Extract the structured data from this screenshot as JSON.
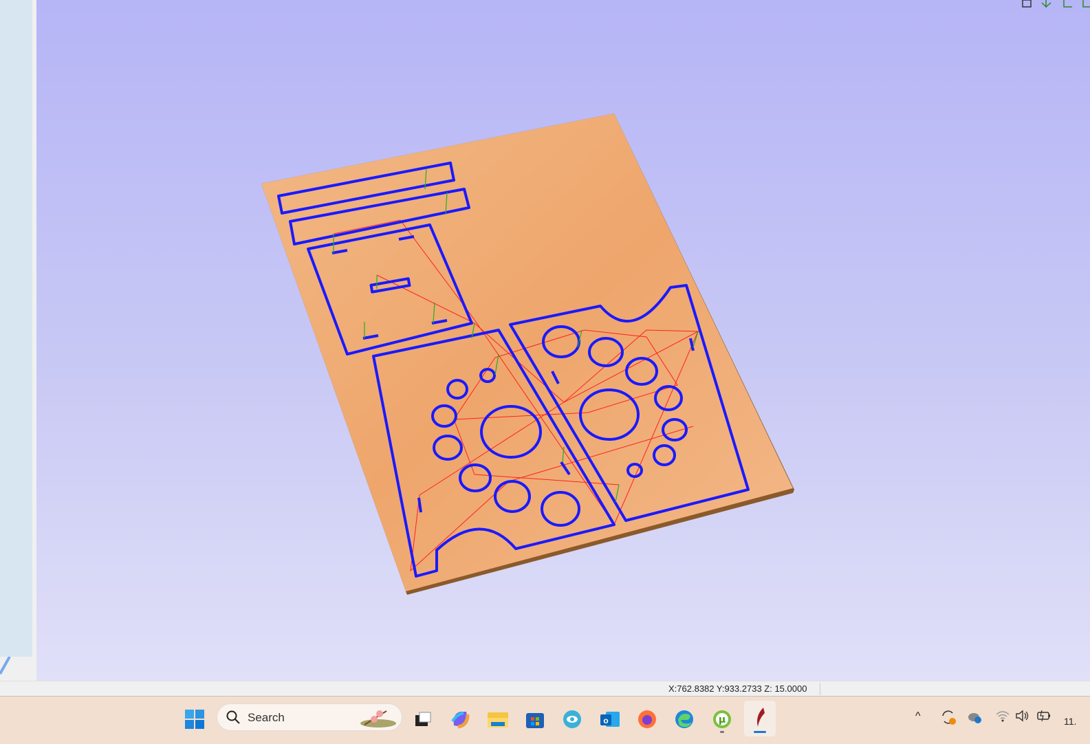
{
  "status": {
    "coords": "X:762.8382 Y:933.2733 Z: 15.0000"
  },
  "taskbar": {
    "search_placeholder": "Search",
    "clock": "11.",
    "apps": [
      "start-icon",
      "task-view-icon",
      "copilot-icon",
      "file-explorer-icon",
      "store-icon",
      "app-icon",
      "outlook-icon",
      "firefox-icon",
      "edge-icon",
      "utorrent-icon",
      "cnc-app-icon"
    ]
  },
  "colors": {
    "toolpath": "#1a1aff",
    "rapid": "#ff2020",
    "plunge": "#20b020",
    "board": "#eda56c"
  }
}
